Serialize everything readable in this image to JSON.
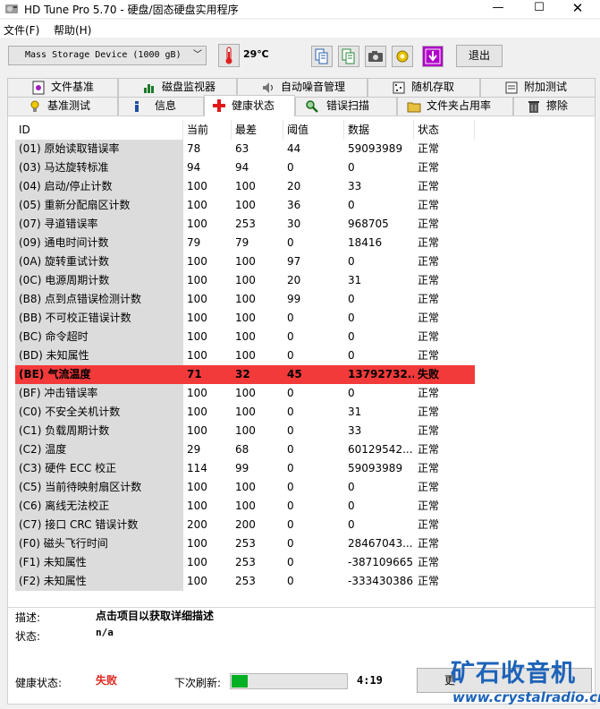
{
  "window": {
    "title": "HD Tune Pro 5.70 - 硬盘/固态硬盘实用程序",
    "min": "—",
    "max": "☐",
    "close": "✕"
  },
  "menu": [
    "文件(F)",
    "帮助(H)"
  ],
  "toolbar": {
    "device": "Mass Storage Device (1000 gB)",
    "temperature": "29℃",
    "exit": "退出"
  },
  "tabs_row1": [
    "文件基准",
    "磁盘监视器",
    "自动噪音管理",
    "随机存取",
    "附加测试"
  ],
  "tabs_row2": [
    "基准测试",
    "信息",
    "健康状态",
    "错误扫描",
    "文件夹占用率",
    "擦除"
  ],
  "table": {
    "headers": [
      "ID",
      "当前",
      "最差",
      "阈值",
      "数据",
      "状态"
    ],
    "rows": [
      [
        "(01) 原始读取错误率",
        "78",
        "63",
        "44",
        "59093989",
        "正常"
      ],
      [
        "(03) 马达旋转标准",
        "94",
        "94",
        "0",
        "0",
        "正常"
      ],
      [
        "(04) 启动/停止计数",
        "100",
        "100",
        "20",
        "33",
        "正常"
      ],
      [
        "(05) 重新分配扇区计数",
        "100",
        "100",
        "36",
        "0",
        "正常"
      ],
      [
        "(07) 寻道错误率",
        "100",
        "253",
        "30",
        "968705",
        "正常"
      ],
      [
        "(09) 通电时间计数",
        "79",
        "79",
        "0",
        "18416",
        "正常"
      ],
      [
        "(0A) 旋转重试计数",
        "100",
        "100",
        "97",
        "0",
        "正常"
      ],
      [
        "(0C) 电源周期计数",
        "100",
        "100",
        "20",
        "31",
        "正常"
      ],
      [
        "(B8) 点到点错误检测计数",
        "100",
        "100",
        "99",
        "0",
        "正常"
      ],
      [
        "(BB) 不可校正错误计数",
        "100",
        "100",
        "0",
        "0",
        "正常"
      ],
      [
        "(BC) 命令超时",
        "100",
        "100",
        "0",
        "0",
        "正常"
      ],
      [
        "(BD) 未知属性",
        "100",
        "100",
        "0",
        "0",
        "正常"
      ],
      [
        "(BE) 气流温度",
        "71",
        "32",
        "45",
        "13792732...",
        "失败"
      ],
      [
        "(BF) 冲击错误率",
        "100",
        "100",
        "0",
        "0",
        "正常"
      ],
      [
        "(C0) 不安全关机计数",
        "100",
        "100",
        "0",
        "31",
        "正常"
      ],
      [
        "(C1) 负载周期计数",
        "100",
        "100",
        "0",
        "33",
        "正常"
      ],
      [
        "(C2) 温度",
        "29",
        "68",
        "0",
        "60129542...",
        "正常"
      ],
      [
        "(C3) 硬件 ECC 校正",
        "114",
        "99",
        "0",
        "59093989",
        "正常"
      ],
      [
        "(C5) 当前待映射扇区计数",
        "100",
        "100",
        "0",
        "0",
        "正常"
      ],
      [
        "(C6) 离线无法校正",
        "100",
        "100",
        "0",
        "0",
        "正常"
      ],
      [
        "(C7) 接口 CRC 错误计数",
        "200",
        "200",
        "0",
        "0",
        "正常"
      ],
      [
        "(F0) 磁头飞行时间",
        "100",
        "253",
        "0",
        "28467043...",
        "正常"
      ],
      [
        "(F1) 未知属性",
        "100",
        "253",
        "0",
        "-387109665",
        "正常"
      ],
      [
        "(F2) 未知属性",
        "100",
        "253",
        "0",
        "-333430386",
        "正常"
      ]
    ],
    "failed_row_index": 12
  },
  "footer": {
    "desc_label": "描述:",
    "desc_value": "点击项目以获取详细描述",
    "status_label": "状态:",
    "status_value": "n/a",
    "health_label": "健康状态:",
    "health_value": "失败",
    "refresh_label": "下次刷新:",
    "refresh_progress": 0.14,
    "refresh_time": "4:19",
    "update_button": "更"
  },
  "watermark": {
    "name": "矿石收音机",
    "url": "www.crystalradio.cn"
  },
  "colors": {
    "fail_row": "#f23a3a",
    "fail_text": "#e0261e",
    "progress": "#06b025",
    "watermark": "#1d63b8"
  }
}
